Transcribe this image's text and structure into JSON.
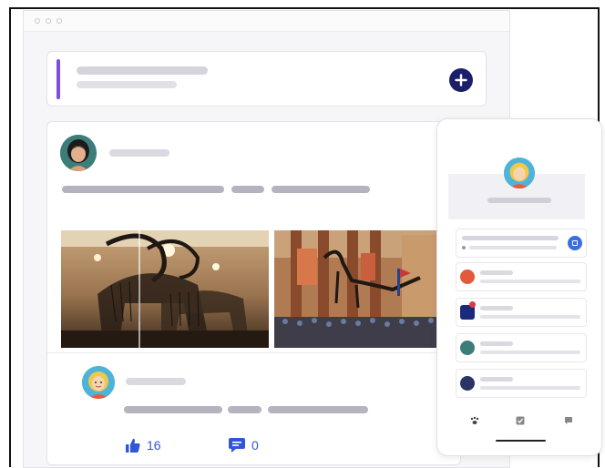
{
  "post": {
    "likes": "16",
    "comments": "0"
  },
  "icons": {
    "add": "plus-icon",
    "like": "thumbs-up-icon",
    "comment": "comment-icon",
    "phone_action": "app-icon",
    "nav": [
      "paw-icon",
      "check-icon",
      "chat-icon"
    ]
  },
  "colors": {
    "accent": "#7c4dde",
    "primary": "#1b1f6b",
    "link": "#2f57d6",
    "skeleton": "#d4d4dc"
  }
}
